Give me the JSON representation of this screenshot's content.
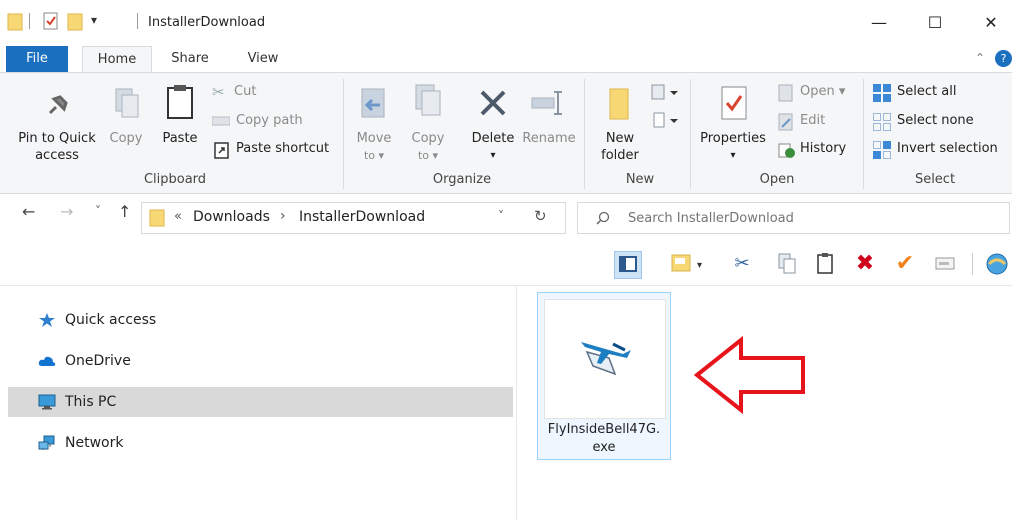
{
  "window": {
    "title": "InstallerDownload",
    "controls": {
      "minimize": "—",
      "maximize": "☐",
      "close": "✕"
    }
  },
  "quick_access_toolbar": {
    "customize": "▾"
  },
  "ribbon_tabs": [
    {
      "label": "File",
      "active": false
    },
    {
      "label": "Home",
      "active": true
    },
    {
      "label": "Share",
      "active": false
    },
    {
      "label": "View",
      "active": false
    }
  ],
  "ribbon": {
    "clipboard": {
      "pin_line1": "Pin to Quick",
      "pin_line2": "access",
      "copy": "Copy",
      "paste": "Paste",
      "cut": "Cut",
      "copy_path": "Copy path",
      "paste_shortcut": "Paste shortcut",
      "group": "Clipboard"
    },
    "organize": {
      "move_to_1": "Move",
      "move_to_2": "to ▾",
      "copy_to_1": "Copy",
      "copy_to_2": "to ▾",
      "delete": "Delete",
      "delete_arrow": "▾",
      "rename": "Rename",
      "group": "Organize"
    },
    "new": {
      "folder_1": "New",
      "folder_2": "folder",
      "group": "New"
    },
    "open": {
      "properties": "Properties",
      "properties_arrow": "▾",
      "open": "Open ▾",
      "edit": "Edit",
      "history": "History",
      "group": "Open"
    },
    "select": {
      "select_all": "Select all",
      "select_none": "Select none",
      "invert": "Invert selection",
      "group": "Select"
    }
  },
  "address": {
    "back": "←",
    "forward": "→",
    "recent": "˅",
    "up": "↑",
    "chevron": "«",
    "crumb1": "Downloads",
    "sep": "›",
    "crumb2": "InstallerDownload",
    "dropdown": "˅",
    "refresh": "↻"
  },
  "search": {
    "placeholder": "Search InstallerDownload"
  },
  "nav_pane": [
    {
      "label": "Quick access",
      "icon": "star-icon"
    },
    {
      "label": "OneDrive",
      "icon": "cloud-icon"
    },
    {
      "label": "This PC",
      "icon": "computer-icon",
      "selected": true
    },
    {
      "label": "Network",
      "icon": "network-icon"
    }
  ],
  "files": [
    {
      "name": "FlyInsideBell47G.exe",
      "line1": "FlyInsideBell47G.",
      "line2": "exe",
      "selected": true
    }
  ],
  "colors": {
    "accent": "#1a6fbe",
    "selection_bg": "#d9d9d9",
    "annotation_arrow": "#e8141b"
  }
}
